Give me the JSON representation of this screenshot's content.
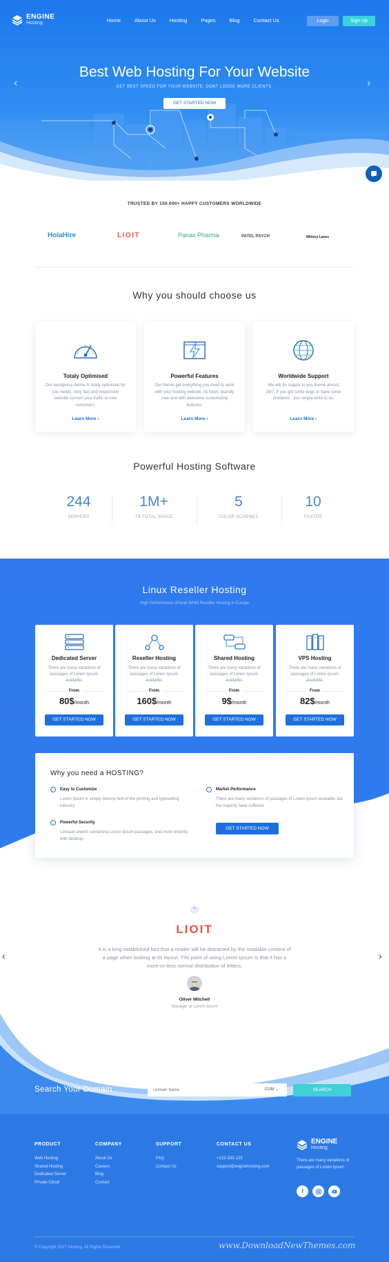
{
  "brand": {
    "name": "ENGINE",
    "tagline": "Hosting"
  },
  "nav": {
    "items": [
      "Home",
      "About Us",
      "Hosting",
      "Pages",
      "Blog",
      "Contact Us"
    ],
    "login": "Login",
    "signup": "Sign Up"
  },
  "hero": {
    "title": "Best Web Hosting For Your Website",
    "subtitle": "GET BEST SPEED FOR YOUR WEBSITE, DONT LOOSE MORE CLIENTS.",
    "cta": "GET STARTED NOW"
  },
  "trusted": {
    "text": "TRUSTED BY 150,000+ HAPPY CUSTOMERS WORLDWIDE",
    "brands": [
      "HolaHire",
      "LIOIT",
      "Panax Pharma",
      "PATEL PSYCH",
      "Mkinny Lanes"
    ]
  },
  "why": {
    "title": "Why you should choose us",
    "cards": [
      {
        "icon": "speedometer-icon",
        "title": "Totaly Optimised",
        "text": "Our wordpress theme is totaly optimised for you needs. Very fast and responsive website convert your traffic to new customers.",
        "link": "Learn More"
      },
      {
        "icon": "flash-icon",
        "title": "Powerful Features",
        "text": "Our theme get everything you need to work with your hosting website. Its fresh, brandly new and with awesome customizing features.",
        "link": "Learn More"
      },
      {
        "icon": "globe-icon",
        "title": "Worldwide Support",
        "text": "We will do suppor to you theme almost 24/7. If you get some bugs or have some problems - just simply write to us.",
        "link": "Learn More"
      }
    ]
  },
  "software": {
    "title": "Powerful Hosting Software",
    "stats": [
      {
        "value": "244",
        "label": "SERVERS"
      },
      {
        "value": "1M+",
        "label": "TB TOTAL SPACE"
      },
      {
        "value": "5",
        "label": "COLOR SCHEMES"
      },
      {
        "value": "10",
        "label": "FASTER"
      }
    ]
  },
  "reseller": {
    "title": "Linux Reseller Hosting",
    "subtitle": "High Performance cPanel WHM Reseller Hosting in Europe",
    "plans": [
      {
        "icon": "server-icon",
        "name": "Dedicated Server",
        "desc": "There are many variations of passages of Lorem Ipsum available.",
        "from": "From",
        "price": "80$",
        "period": "/month",
        "button": "GET STARTED NOW"
      },
      {
        "icon": "network-icon",
        "name": "Reseller Hosting",
        "desc": "There are many variations of passages of Lorem Ipsum available.",
        "from": "From",
        "price": "160$",
        "period": "/month",
        "button": "GET STARTED NOW"
      },
      {
        "icon": "shared-icon",
        "name": "Shared Hosting",
        "desc": "There are many variations of passages of Lorem Ipsum available.",
        "from": "From",
        "price": "9$",
        "period": "/month",
        "button": "GET STARTED NOW"
      },
      {
        "icon": "vps-icon",
        "name": "VPS Hosting",
        "desc": "There are many variations of passages of Lorem Ipsum available.",
        "from": "From",
        "price": "82$",
        "period": "/month",
        "button": "GET STARTED NOW"
      }
    ]
  },
  "need": {
    "title": "Why you need a HOSTING?",
    "items": [
      {
        "title": "Easy to Customize",
        "text": "Lorem Ipsum is simply dummy text of the printing and typesetting industry."
      },
      {
        "title": "Market Performance",
        "text": "There are many variations of passages of Lorem Ipsum available, but the majority have suffered."
      },
      {
        "title": "Powerful Security",
        "text": "Letraset sheets containing Lorem Ipsum passages, and more recently with desktop."
      }
    ],
    "button": "GET STARTED NOW"
  },
  "testimonial": {
    "quote_mark": "“",
    "logo": "LIOIT",
    "text": "It is a long established fact that a reader will be distracted by the readable content of a page when looking at its layout. The point of using Lorem Ipsum is that it has a more-or-less normal distribution of letters.",
    "name": "Oliver Mitchell",
    "role": "Manager at Lorem Ipsum"
  },
  "domain": {
    "title": "Search Your Domain",
    "placeholder": "Domain Name",
    "tld": ".COM",
    "button": "SEARCH"
  },
  "footer": {
    "product": {
      "title": "PRODUCT",
      "items": [
        "Web Hosting",
        "Shared Hosting",
        "Dedicated Server",
        "Private Cloud"
      ]
    },
    "company": {
      "title": "COMPANY",
      "items": [
        "About Us",
        "Careers",
        "Blog",
        "Contact"
      ]
    },
    "support": {
      "title": "SUPPORT",
      "items": [
        "FAQ",
        "Contact Us"
      ]
    },
    "contact": {
      "title": "CONTACT US",
      "items": [
        "+123-333-123",
        "support@enginehosting.com"
      ]
    },
    "about": "There are many variations of passages of Lorem Ipsum",
    "copyright": "© Copyright 2017 Hosting. All Rights Reserved",
    "watermark": "www.DownloadNewThemes.com"
  },
  "colors": {
    "primary": "#1d6fe0",
    "accent": "#3ed1d7",
    "hero_top": "#1c78ec",
    "section_blue": "#2f7cee",
    "footer_blue": "#2b7be7"
  }
}
